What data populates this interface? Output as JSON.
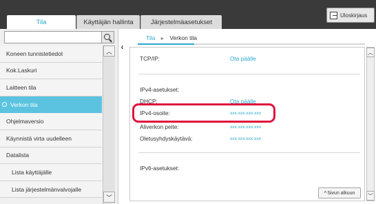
{
  "tabs": {
    "main": "Tila",
    "users": "Käyttäjän hallinta",
    "system": "Järjestelmäasetukset"
  },
  "logout_label": "Uloskirjaus",
  "search": {
    "value": ""
  },
  "menu": [
    {
      "label": "Koneen tunnistetiedot"
    },
    {
      "label": "Kok.Laskuri"
    },
    {
      "label": "Laitteen tila"
    },
    {
      "label": "Verkon tila"
    },
    {
      "label": "Ohjelmaversio"
    },
    {
      "label": "Käynnistä virta uudelleen"
    },
    {
      "label": "Datalista"
    },
    {
      "label": "Lista käyttäjälle"
    },
    {
      "label": "Lista järjestelmänvalvojalle"
    }
  ],
  "breadcrumb": {
    "root": "Tila",
    "current": "Verkon tila"
  },
  "content": {
    "tcpip_label": "TCP/IP:",
    "tcpip_value": "Ota päälle",
    "ipv4_section": "IPv4-asetukset:",
    "dhcp_label": "DHCP:",
    "dhcp_value": "Ota päälle",
    "ipv4_addr_label": "IPv4-osoite:",
    "ipv4_addr_value": "xxx.xxx.xxx.xxx",
    "subnet_label": "Aliverkon peite:",
    "subnet_value": "xxx.xxx.xxx.xxx",
    "gateway_label": "Oletusyhdyskäytävä:",
    "gateway_value": "xxx.xxx.xxx.xxx",
    "ipv6_section": "IPv6-asetukset:"
  },
  "top_button": "Sivun alkuun",
  "colors": {
    "accent": "#2aa8cc",
    "highlight": "#e0103d",
    "active_menu": "#5bc3e0",
    "topbar": "#3a3a3a"
  }
}
